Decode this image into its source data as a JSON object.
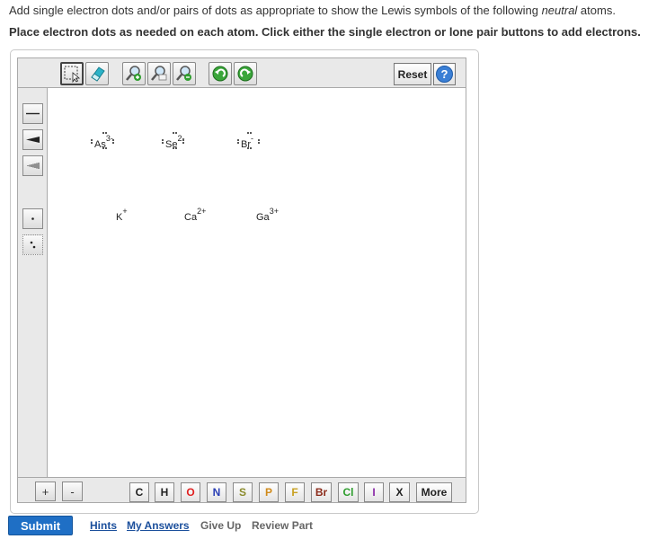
{
  "question": {
    "line1_before": "Add single electron dots and/or pairs of dots as appropriate to show the Lewis symbols of the following ",
    "line1_emph": "neutral",
    "line1_after": " atoms.",
    "line2": "Place electron dots as needed on each atom. Click either the single electron or lone pair buttons to add electrons."
  },
  "toolbar": {
    "reset_label": "Reset",
    "help_label": "?",
    "icons": [
      "marquee-select-icon",
      "eraser-icon",
      "zoom-in-icon",
      "zoom-reset-icon",
      "zoom-out-icon",
      "undo-icon",
      "redo-icon"
    ]
  },
  "left_tools": [
    "single-bond-icon",
    "wedge-bond-icon",
    "hash-bond-icon",
    "single-electron-icon",
    "lone-pair-icon"
  ],
  "atoms": [
    {
      "symbol": "As",
      "charge": "3-"
    },
    {
      "symbol": "Se",
      "charge": "2-"
    },
    {
      "symbol": "Br",
      "charge": "-"
    },
    {
      "symbol": "K",
      "charge": "+"
    },
    {
      "symbol": "Ca",
      "charge": "2+"
    },
    {
      "symbol": "Ga",
      "charge": "3+"
    }
  ],
  "zoom": {
    "plus": "+",
    "minus": "-"
  },
  "elements": [
    {
      "label": "C",
      "color": "#222222"
    },
    {
      "label": "H",
      "color": "#222222"
    },
    {
      "label": "O",
      "color": "#e02020"
    },
    {
      "label": "N",
      "color": "#2a3fb5"
    },
    {
      "label": "S",
      "color": "#8a8a2a"
    },
    {
      "label": "P",
      "color": "#d08a1a"
    },
    {
      "label": "F",
      "color": "#c8a020"
    },
    {
      "label": "Br",
      "color": "#8b2b1a"
    },
    {
      "label": "Cl",
      "color": "#2f9e2f"
    },
    {
      "label": "I",
      "color": "#8a2aa8"
    },
    {
      "label": "X",
      "color": "#222222"
    },
    {
      "label": "More",
      "color": "#222222"
    }
  ],
  "footer": {
    "submit": "Submit",
    "hints": "Hints",
    "my_answers": "My Answers",
    "give_up": "Give Up",
    "review_part": "Review Part"
  }
}
